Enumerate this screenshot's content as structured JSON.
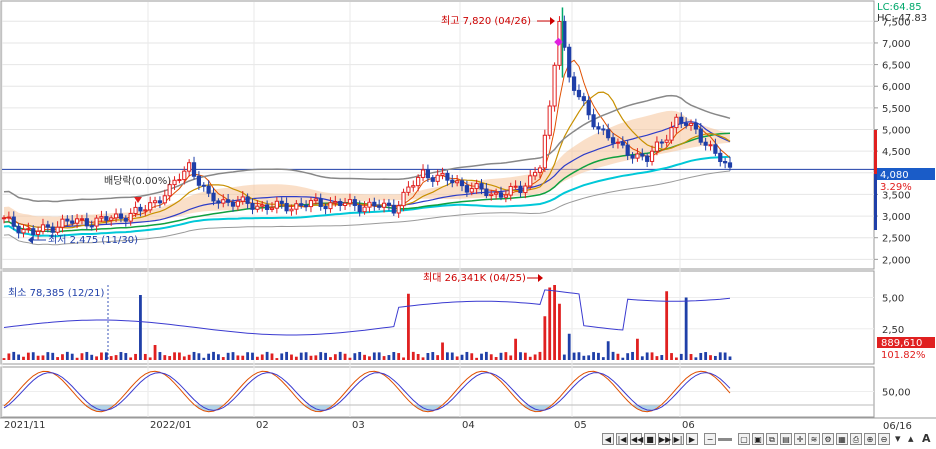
{
  "chart_data": [
    {
      "type": "candlestick",
      "panel": "price",
      "y_ticks": [
        2000,
        2500,
        3000,
        3500,
        4000,
        4500,
        5000,
        5500,
        6000,
        6500,
        7000,
        7500
      ],
      "y_tick_labels": [
        "2,000",
        "2,500",
        "3,000",
        "3,500",
        "4,000",
        "4,500",
        "5,000",
        "5,500",
        "6,000",
        "6,500",
        "7,000",
        "7,500"
      ],
      "ylim": [
        1800,
        7900
      ],
      "x_labels": [
        "2021/11",
        "2022/01",
        "02",
        "03",
        "04",
        "05",
        "06"
      ],
      "right_label": "06/16",
      "high_annotation": "최고 7,820 (04/26)",
      "low_annotation": "최저 2,475 (11/30)",
      "dividend_annotation": "배당락(0.00%)",
      "info": {
        "lc": "LC:64.85",
        "hc": "HC:-47.83"
      },
      "current_price": 4080,
      "current_price_label": "4,080",
      "change_label": "3.29%",
      "colors": {
        "up": "#e02020",
        "down": "#1f3fa8",
        "accent": "#00a86b"
      }
    },
    {
      "type": "bar",
      "panel": "volume",
      "y_ticks": [
        2.5,
        5.0
      ],
      "y_tick_labels": [
        "2,50",
        "5,00"
      ],
      "max_annotation": "최대 26,341K (04/25)",
      "min_annotation": "최소 78,385 (12/21)",
      "value_label": "889,610",
      "ratio_label": "101.82%"
    },
    {
      "type": "line",
      "panel": "oscillator",
      "y_ticks": [
        50
      ],
      "y_tick_labels": [
        "50,00"
      ]
    }
  ]
}
